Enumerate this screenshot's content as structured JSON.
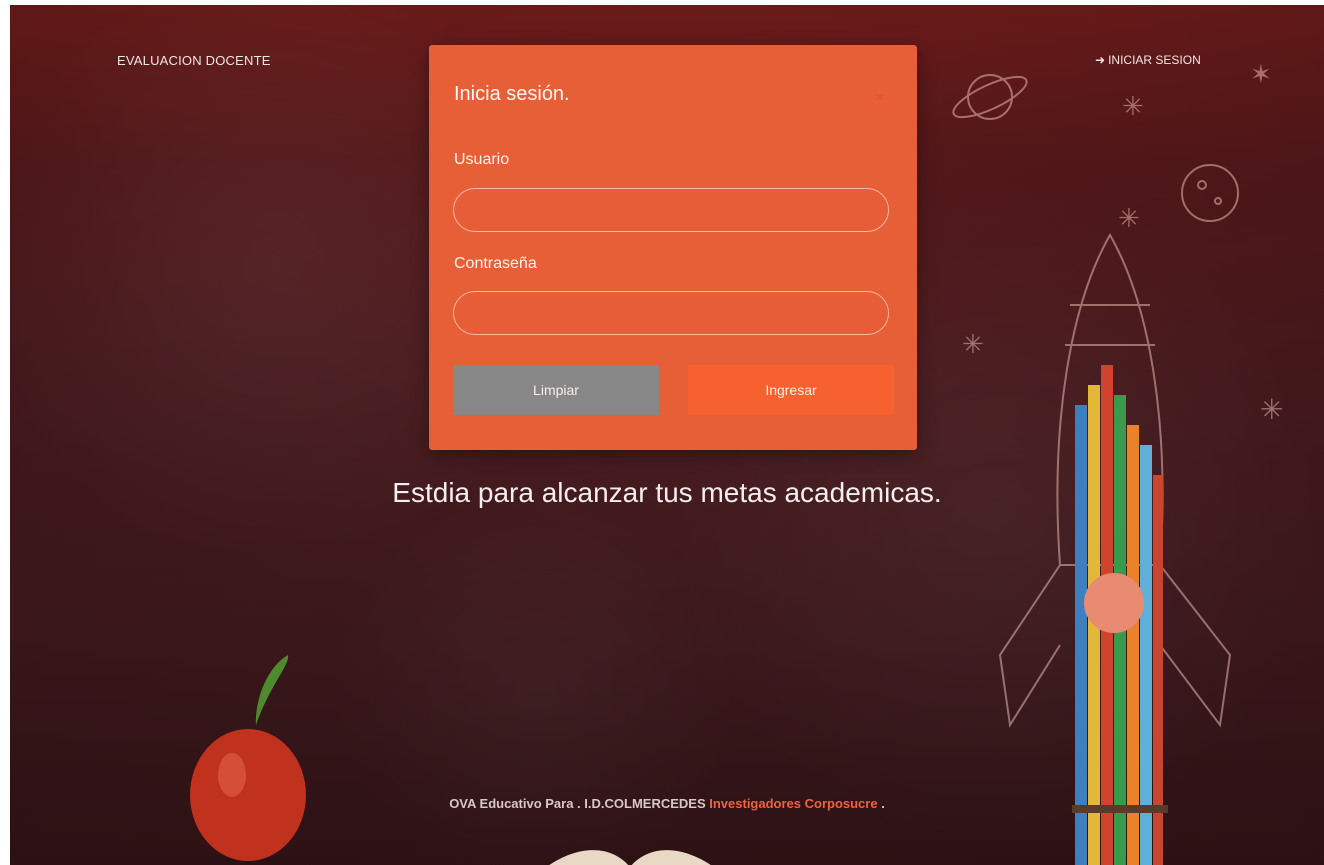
{
  "nav": {
    "brand": "EVALUACION DOCENTE",
    "login_label": "INICIAR SESION",
    "login_icon": "sign-in-icon"
  },
  "modal": {
    "title": "Inicia sesión.",
    "close_symbol": "×",
    "username_label": "Usuario",
    "username_value": "",
    "password_label": "Contraseña",
    "password_value": "",
    "clear_label": "Limpiar",
    "submit_label": "Ingresar"
  },
  "tagline": "Estdia para alcanzar tus metas academicas.",
  "footer": {
    "text": "OVA Educativo Para . I.D.COLMERCEDES",
    "accent": "Investigadores Corposucre",
    "suffix": " ."
  },
  "colors": {
    "modal_bg": "#e75f36",
    "clear_button": "#878787",
    "submit_button": "#f7612f",
    "accent": "#f0623c",
    "background": "#4a1c20"
  }
}
